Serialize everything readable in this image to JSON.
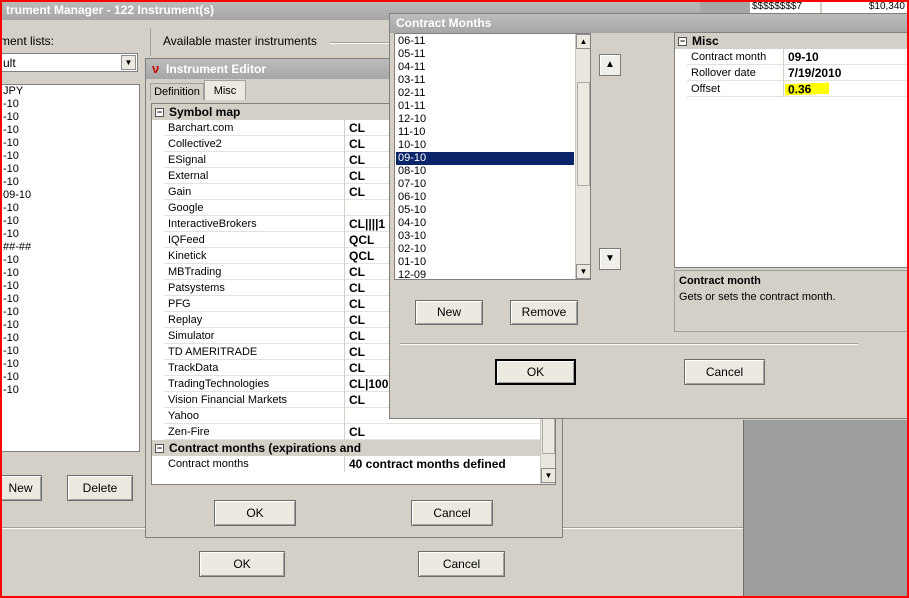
{
  "instrument_manager": {
    "title": "trument Manager - 122 Instrument(s)",
    "lists_label": "ment lists:",
    "list_select_value": "ult",
    "available_label": "Available master instruments",
    "instruments": [
      "JPY",
      "-10",
      "-10",
      "-10",
      "-10",
      "-10",
      "-10",
      "-10",
      "09-10",
      "-10",
      "-10",
      "-10",
      "##-##",
      "-10",
      "-10",
      "-10",
      "-10",
      "-10",
      "-10",
      "-10",
      "-10",
      "-10",
      "-10",
      "-10"
    ],
    "new_button": "New",
    "delete_button": "Delete",
    "ok_button": "OK",
    "cancel_button": "Cancel",
    "top_right_values": [
      "$$$$$$$$7",
      "$10,340"
    ]
  },
  "instrument_editor": {
    "title": "Instrument Editor",
    "tabs": [
      "Definition",
      "Misc"
    ],
    "symbol_map_header": "Symbol map",
    "symbol_map": [
      {
        "name": "Barchart.com",
        "value": "CL"
      },
      {
        "name": "Collective2",
        "value": "CL"
      },
      {
        "name": "ESignal",
        "value": "CL"
      },
      {
        "name": "External",
        "value": "CL"
      },
      {
        "name": "Gain",
        "value": "CL"
      },
      {
        "name": "Google",
        "value": ""
      },
      {
        "name": "InteractiveBrokers",
        "value": "CL||||1"
      },
      {
        "name": "IQFeed",
        "value": "QCL"
      },
      {
        "name": "Kinetick",
        "value": "QCL"
      },
      {
        "name": "MBTrading",
        "value": "CL"
      },
      {
        "name": "Patsystems",
        "value": "CL"
      },
      {
        "name": "PFG",
        "value": "CL"
      },
      {
        "name": "Replay",
        "value": "CL"
      },
      {
        "name": "Simulator",
        "value": "CL"
      },
      {
        "name": "TD AMERITRADE",
        "value": "CL"
      },
      {
        "name": "TrackData",
        "value": "CL"
      },
      {
        "name": "TradingTechnologies",
        "value": "CL|100"
      },
      {
        "name": "Vision Financial Markets",
        "value": "CL"
      },
      {
        "name": "Yahoo",
        "value": ""
      },
      {
        "name": "Zen-Fire",
        "value": "CL"
      }
    ],
    "contract_months_header": "Contract months (expirations and",
    "contract_months_name": "Contract months",
    "contract_months_value": "40 contract months defined",
    "ok_button": "OK",
    "cancel_button": "Cancel"
  },
  "contract_months": {
    "title": "Contract Months",
    "months": [
      "06-11",
      "05-11",
      "04-11",
      "03-11",
      "02-11",
      "01-11",
      "12-10",
      "11-10",
      "10-10",
      "09-10",
      "08-10",
      "07-10",
      "06-10",
      "05-10",
      "04-10",
      "03-10",
      "02-10",
      "01-10",
      "12-09"
    ],
    "selected_index": 9,
    "new_button": "New",
    "remove_button": "Remove",
    "ok_button": "OK",
    "cancel_button": "Cancel",
    "misc_header": "Misc",
    "properties": [
      {
        "name": "Contract month",
        "value": "09-10"
      },
      {
        "name": "Rollover date",
        "value": "7/19/2010"
      },
      {
        "name": "Offset",
        "value": "0.36"
      }
    ],
    "highlight_color": "#ffff00",
    "description_title": "Contract month",
    "description_text": "Gets or sets the contract month."
  },
  "frame_color": "#ff0000",
  "selection_color": "#0a246a"
}
